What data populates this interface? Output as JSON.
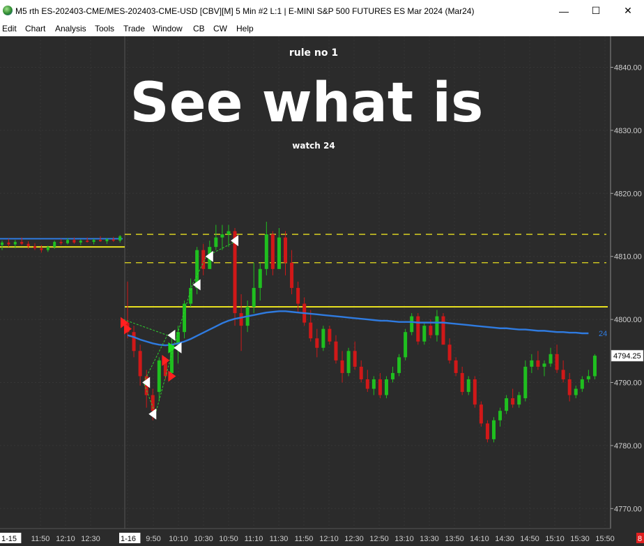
{
  "window": {
    "title": "M5 rth ES-202403-CME/MES-202403-CME-USD [CBV][M]  5 Min  #2 L:1 | E-MINI S&P 500 FUTURES ES Mar 2024 (Mar24)",
    "minimize": "—",
    "maximize": "☐",
    "close": "✕"
  },
  "menu": [
    "Edit",
    "Chart",
    "Analysis",
    "Tools",
    "Trade",
    "Window",
    "CB",
    "CW",
    "Help"
  ],
  "overlay": {
    "rule": "rule no 1",
    "headline": "See what is",
    "sub": "watch 24"
  },
  "colors": {
    "background": "#2b2b2b",
    "up": "#1fbf1f",
    "down": "#d01818",
    "ma": "#2f7be0",
    "level": "#e8e020"
  },
  "chart_data": {
    "type": "candlestick",
    "timeframe": "5 Min",
    "y_ticks": [
      "4840.00",
      "4830.00",
      "4820.00",
      "4810.00",
      "4800.00",
      "4790.00",
      "4780.00",
      "4770.00"
    ],
    "ylim": [
      4768,
      4846
    ],
    "current_price": "4794.25",
    "ma_label": "24",
    "session_badge": "8",
    "x_labels": [
      {
        "label": "1-15",
        "session": true
      },
      {
        "label": "11:50"
      },
      {
        "label": "12:10"
      },
      {
        "label": "12:30"
      },
      {
        "label": "1-16",
        "session": true
      },
      {
        "label": "9:50"
      },
      {
        "label": "10:10"
      },
      {
        "label": "10:30"
      },
      {
        "label": "10:50"
      },
      {
        "label": "11:10"
      },
      {
        "label": "11:30"
      },
      {
        "label": "11:50"
      },
      {
        "label": "12:10"
      },
      {
        "label": "12:30"
      },
      {
        "label": "12:50"
      },
      {
        "label": "13:10"
      },
      {
        "label": "13:30"
      },
      {
        "label": "13:50"
      },
      {
        "label": "14:10"
      },
      {
        "label": "14:30"
      },
      {
        "label": "14:50"
      },
      {
        "label": "15:10"
      },
      {
        "label": "15:30"
      },
      {
        "label": "15:50"
      }
    ],
    "levels": [
      {
        "price": 4813.5,
        "style": "dashed",
        "segment": "today"
      },
      {
        "price": 4809.0,
        "style": "dashed",
        "segment": "today"
      },
      {
        "price": 4802.0,
        "style": "solid",
        "segment": "today"
      },
      {
        "price": 4811.5,
        "style": "solid",
        "segment": "prior"
      },
      {
        "price": 4812.8,
        "style": "solid",
        "segment": "prior-blue"
      }
    ],
    "prior_session": [
      [
        4811.8,
        4812.5,
        4811.0,
        4812.2
      ],
      [
        4812.2,
        4812.8,
        4811.5,
        4811.9
      ],
      [
        4811.9,
        4812.6,
        4811.3,
        4812.3
      ],
      [
        4812.3,
        4813.0,
        4811.8,
        4812.0
      ],
      [
        4812.0,
        4812.4,
        4811.2,
        4811.6
      ],
      [
        4811.6,
        4812.1,
        4811.0,
        4811.3
      ],
      [
        4811.3,
        4811.8,
        4810.6,
        4811.0
      ],
      [
        4811.0,
        4811.7,
        4810.7,
        4811.5
      ],
      [
        4811.5,
        4812.5,
        4811.2,
        4812.3
      ],
      [
        4812.3,
        4812.8,
        4811.8,
        4812.1
      ],
      [
        4812.1,
        4812.9,
        4811.9,
        4812.6
      ],
      [
        4812.6,
        4813.0,
        4812.0,
        4812.2
      ],
      [
        4812.2,
        4812.7,
        4811.8,
        4812.5
      ],
      [
        4812.5,
        4813.0,
        4812.2,
        4812.3
      ],
      [
        4812.3,
        4812.8,
        4811.9,
        4812.6
      ],
      [
        4812.6,
        4813.2,
        4812.3,
        4812.4
      ],
      [
        4812.4,
        4812.9,
        4812.0,
        4812.7
      ],
      [
        4812.7,
        4813.1,
        4812.3,
        4812.5
      ],
      [
        4812.5,
        4813.4,
        4812.2,
        4813.2
      ]
    ],
    "session_candles": [
      [
        4799.5,
        4806.0,
        4797.0,
        4798.0
      ],
      [
        4798.0,
        4799.0,
        4794.0,
        4795.0
      ],
      [
        4795.0,
        4796.0,
        4789.5,
        4791.0
      ],
      [
        4791.0,
        4792.0,
        4786.0,
        4788.0
      ],
      [
        4788.0,
        4789.0,
        4784.0,
        4785.5
      ],
      [
        4788.5,
        4794.0,
        4787.0,
        4793.5
      ],
      [
        4793.5,
        4794.0,
        4790.5,
        4791.0
      ],
      [
        4791.5,
        4797.0,
        4791.0,
        4796.0
      ],
      [
        4796.0,
        4799.0,
        4793.0,
        4798.0
      ],
      [
        4798.0,
        4803.0,
        4797.0,
        4802.5
      ],
      [
        4802.5,
        4806.5,
        4802.0,
        4805.0
      ],
      [
        4805.0,
        4811.5,
        4804.0,
        4811.0
      ],
      [
        4811.0,
        4812.0,
        4807.0,
        4808.0
      ],
      [
        4808.0,
        4812.5,
        4808.0,
        4811.5
      ],
      [
        4811.5,
        4815.0,
        4811.0,
        4813.0
      ],
      [
        4813.0,
        4815.0,
        4811.0,
        4813.5
      ],
      [
        4813.5,
        4815.0,
        4811.5,
        4814.0
      ],
      [
        4814.0,
        4814.5,
        4799.0,
        4801.0
      ],
      [
        4801.0,
        4804.0,
        4795.0,
        4799.0
      ],
      [
        4799.0,
        4803.0,
        4798.0,
        4802.0
      ],
      [
        4802.0,
        4809.0,
        4801.0,
        4805.0
      ],
      [
        4805.0,
        4809.0,
        4803.0,
        4808.0
      ],
      [
        4808.0,
        4815.5,
        4807.0,
        4813.5
      ],
      [
        4813.5,
        4814.0,
        4807.0,
        4808.0
      ],
      [
        4808.0,
        4814.5,
        4808.0,
        4813.0
      ],
      [
        4813.0,
        4814.0,
        4807.0,
        4809.0
      ],
      [
        4809.0,
        4811.0,
        4804.0,
        4805.0
      ],
      [
        4805.0,
        4806.0,
        4801.0,
        4802.5
      ],
      [
        4802.5,
        4803.5,
        4799.0,
        4799.5
      ],
      [
        4799.5,
        4801.5,
        4796.5,
        4797.0
      ],
      [
        4797.0,
        4798.5,
        4794.0,
        4795.5
      ],
      [
        4795.5,
        4799.0,
        4795.0,
        4798.5
      ],
      [
        4798.5,
        4799.0,
        4796.0,
        4796.5
      ],
      [
        4796.5,
        4797.5,
        4793.0,
        4793.5
      ],
      [
        4793.5,
        4795.0,
        4790.0,
        4791.5
      ],
      [
        4791.5,
        4795.5,
        4791.0,
        4795.0
      ],
      [
        4795.0,
        4796.5,
        4792.0,
        4792.5
      ],
      [
        4792.5,
        4793.5,
        4790.0,
        4790.5
      ],
      [
        4790.5,
        4792.0,
        4788.5,
        4789.0
      ],
      [
        4789.0,
        4791.0,
        4788.0,
        4790.5
      ],
      [
        4790.5,
        4791.5,
        4787.5,
        4788.0
      ],
      [
        4788.0,
        4791.0,
        4787.5,
        4790.5
      ],
      [
        4790.5,
        4792.5,
        4790.0,
        4791.5
      ],
      [
        4791.5,
        4794.5,
        4791.0,
        4794.0
      ],
      [
        4794.0,
        4798.5,
        4793.5,
        4798.0
      ],
      [
        4798.0,
        4801.0,
        4797.5,
        4800.5
      ],
      [
        4800.5,
        4801.0,
        4796.0,
        4796.5
      ],
      [
        4796.5,
        4799.5,
        4796.0,
        4799.0
      ],
      [
        4799.0,
        4800.0,
        4797.0,
        4797.5
      ],
      [
        4797.5,
        4801.5,
        4796.5,
        4800.5
      ],
      [
        4800.5,
        4801.0,
        4796.0,
        4796.0
      ],
      [
        4796.0,
        4797.0,
        4793.0,
        4793.5
      ],
      [
        4793.5,
        4794.0,
        4791.0,
        4791.5
      ],
      [
        4791.5,
        4792.5,
        4788.0,
        4788.5
      ],
      [
        4788.5,
        4791.0,
        4788.0,
        4790.5
      ],
      [
        4790.5,
        4791.0,
        4786.0,
        4786.5
      ],
      [
        4786.5,
        4787.0,
        4783.0,
        4783.5
      ],
      [
        4783.5,
        4784.0,
        4780.5,
        4781.0
      ],
      [
        4781.0,
        4784.5,
        4780.5,
        4784.0
      ],
      [
        4784.0,
        4786.0,
        4783.0,
        4785.5
      ],
      [
        4785.5,
        4788.0,
        4785.0,
        4787.5
      ],
      [
        4787.5,
        4789.0,
        4786.0,
        4786.5
      ],
      [
        4786.5,
        4788.5,
        4786.0,
        4788.0
      ],
      [
        4787.5,
        4793.5,
        4787.0,
        4792.5
      ],
      [
        4792.5,
        4794.5,
        4791.5,
        4793.5
      ],
      [
        4793.5,
        4795.0,
        4792.0,
        4792.5
      ],
      [
        4792.5,
        4793.5,
        4791.0,
        4793.0
      ],
      [
        4793.0,
        4795.5,
        4792.5,
        4794.5
      ],
      [
        4794.5,
        4796.0,
        4791.5,
        4792.0
      ],
      [
        4792.0,
        4793.5,
        4790.0,
        4790.5
      ],
      [
        4790.5,
        4791.5,
        4787.0,
        4788.0
      ],
      [
        4788.0,
        4789.5,
        4787.5,
        4789.0
      ],
      [
        4789.0,
        4791.0,
        4788.5,
        4790.5
      ],
      [
        4790.5,
        4792.0,
        4790.0,
        4791.0
      ],
      [
        4791.0,
        4794.5,
        4790.5,
        4794.25
      ]
    ],
    "ma_values": [
      4797.5,
      4797.2,
      4796.8,
      4796.5,
      4796.2,
      4796.0,
      4795.9,
      4796.0,
      4796.2,
      4796.5,
      4796.9,
      4797.4,
      4797.9,
      4798.4,
      4798.9,
      4799.4,
      4799.8,
      4800.1,
      4800.3,
      4800.5,
      4800.7,
      4800.9,
      4801.1,
      4801.2,
      4801.3,
      4801.3,
      4801.2,
      4801.1,
      4801.0,
      4800.9,
      4800.8,
      4800.7,
      4800.6,
      4800.5,
      4800.4,
      4800.3,
      4800.2,
      4800.1,
      4800.0,
      4799.9,
      4799.8,
      4799.8,
      4799.7,
      4799.6,
      4799.6,
      4799.6,
      4799.5,
      4799.5,
      4799.5,
      4799.5,
      4799.5,
      4799.4,
      4799.3,
      4799.2,
      4799.1,
      4799.0,
      4798.9,
      4798.8,
      4798.7,
      4798.6,
      4798.6,
      4798.5,
      4798.4,
      4798.4,
      4798.3,
      4798.2,
      4798.2,
      4798.1,
      4798.0,
      4798.0,
      4797.9,
      4797.9,
      4797.8,
      4797.8
    ],
    "markers": [
      {
        "i": -1,
        "price": 4799.5,
        "color": "red",
        "dir": "right"
      },
      {
        "i": 0,
        "price": 4798.5,
        "color": "red",
        "dir": "right"
      },
      {
        "i": 3,
        "price": 4790.0,
        "color": "white",
        "dir": "left"
      },
      {
        "i": 4,
        "price": 4785.0,
        "color": "white",
        "dir": "left"
      },
      {
        "i": 6,
        "price": 4793.5,
        "color": "red",
        "dir": "right"
      },
      {
        "i": 7,
        "price": 4791.0,
        "color": "red",
        "dir": "right"
      },
      {
        "i": 7,
        "price": 4795.5,
        "color": "green",
        "dir": "right"
      },
      {
        "i": 7,
        "price": 4797.5,
        "color": "white",
        "dir": "left"
      },
      {
        "i": 8,
        "price": 4795.5,
        "color": "white",
        "dir": "left"
      },
      {
        "i": 11,
        "price": 4805.5,
        "color": "white",
        "dir": "left"
      },
      {
        "i": 13,
        "price": 4810.0,
        "color": "white",
        "dir": "left"
      },
      {
        "i": 17,
        "price": 4812.5,
        "color": "white",
        "dir": "left"
      }
    ]
  }
}
